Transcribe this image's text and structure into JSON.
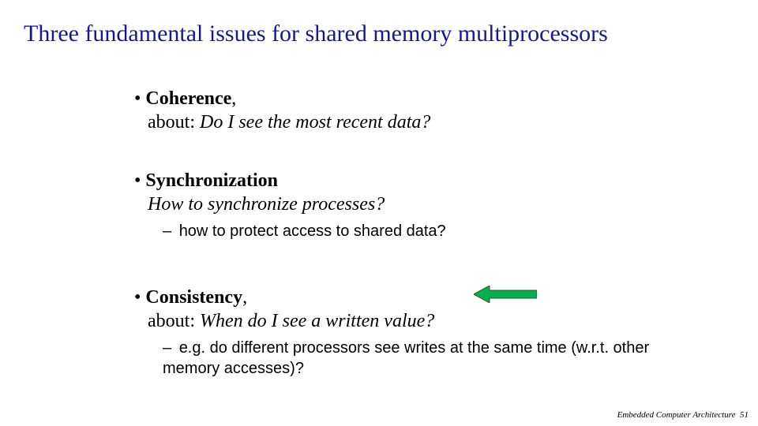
{
  "title": "Three fundamental issues for shared memory multiprocessors",
  "items": [
    {
      "heading_prefix": "• ",
      "heading": "Coherence",
      "heading_suffix": ",",
      "about_label": "about: ",
      "question": "Do I see the most recent data?",
      "subs": []
    },
    {
      "heading_prefix": "• ",
      "heading": "Synchronization",
      "heading_suffix": "",
      "about_label": "",
      "question": "How to synchronize processes?",
      "subs": [
        {
          "dash": "– ",
          "text": "how to protect access to shared data?"
        }
      ]
    },
    {
      "heading_prefix": "• ",
      "heading": "Consistency",
      "heading_suffix": ",",
      "about_label": "about: ",
      "question": "When do I see a written value?",
      "subs": [
        {
          "dash": "– ",
          "text": "e.g. do different processors see writes at the same time (w.r.t. other memory accesses)?"
        }
      ]
    }
  ],
  "footer": {
    "label": "Embedded Computer Architecture",
    "page": "51"
  },
  "arrow": {
    "fill": "#00b050",
    "stroke": "#385723"
  }
}
